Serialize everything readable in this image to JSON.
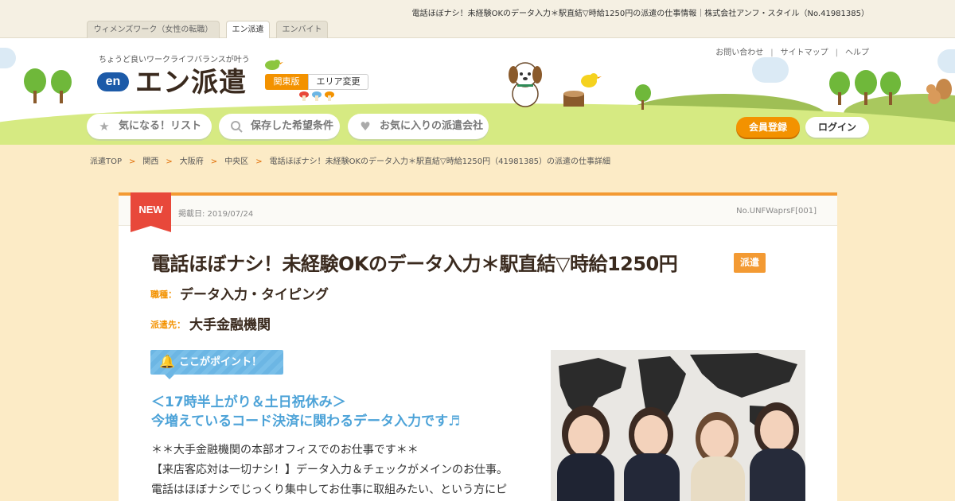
{
  "page_caption": "電話ほぼナシ！未経験OKのデータ入力＊駅直結▽時給1250円の派遣の仕事情報｜株式会社アンフ・スタイル（No.41981385）",
  "site_tabs": [
    {
      "label": "ウィメンズワーク（女性の転職）"
    },
    {
      "label": "エン派遣"
    },
    {
      "label": "エンバイト"
    }
  ],
  "header": {
    "tagline": "ちょうど良いワークライフバランスが叶う",
    "logo_mark": "en",
    "logo_text": "エン派遣",
    "region": "関東版",
    "area_change": "エリア変更",
    "util_links": [
      "お問い合わせ",
      "サイトマップ",
      "ヘルプ"
    ],
    "nav": [
      {
        "label": "気になる！リスト",
        "icon": "star-icon"
      },
      {
        "label": "保存した希望条件",
        "icon": "search-icon"
      },
      {
        "label": "お気に入りの派遣会社",
        "icon": "heart-icon"
      }
    ],
    "register": "会員登録",
    "login": "ログイン"
  },
  "breadcrumb": [
    "派遣TOP",
    "関西",
    "大阪府",
    "中央区",
    "電話ほぼナシ！未経験OKのデータ入力＊駅直結▽時給1250円（41981385）の派遣の仕事詳細"
  ],
  "breadcrumb_sep": ">",
  "job": {
    "new_label": "NEW",
    "posted": "掲載日: 2019/07/24",
    "job_no": "No.UNFWaprsF[001]",
    "title": "電話ほぼナシ！未経験OKのデータ入力＊駅直結▽時給1250円",
    "type_badge": "派遣",
    "category_label": "職種：",
    "category": "データ入力・タイピング",
    "client_label": "派遣先：",
    "client": "大手金融機関",
    "point_label": "ここがポイント！",
    "highlight": [
      "＜17時半上がり＆土日祝休み＞",
      "今増えているコード決済に関わるデータ入力です♬"
    ],
    "description": [
      "＊＊大手金融機関の本部オフィスでのお仕事です＊＊",
      "【来店客応対は一切ナシ！】データ入力＆チェックがメインのお仕事。",
      "電話はほぼナシでじっくり集中してお仕事に取組みたい、という方にピ"
    ]
  },
  "colors": {
    "accent": "#f39200",
    "ribbon": "#e8483a",
    "point": "#6cb6e4",
    "page_bg": "#fcebc6"
  }
}
